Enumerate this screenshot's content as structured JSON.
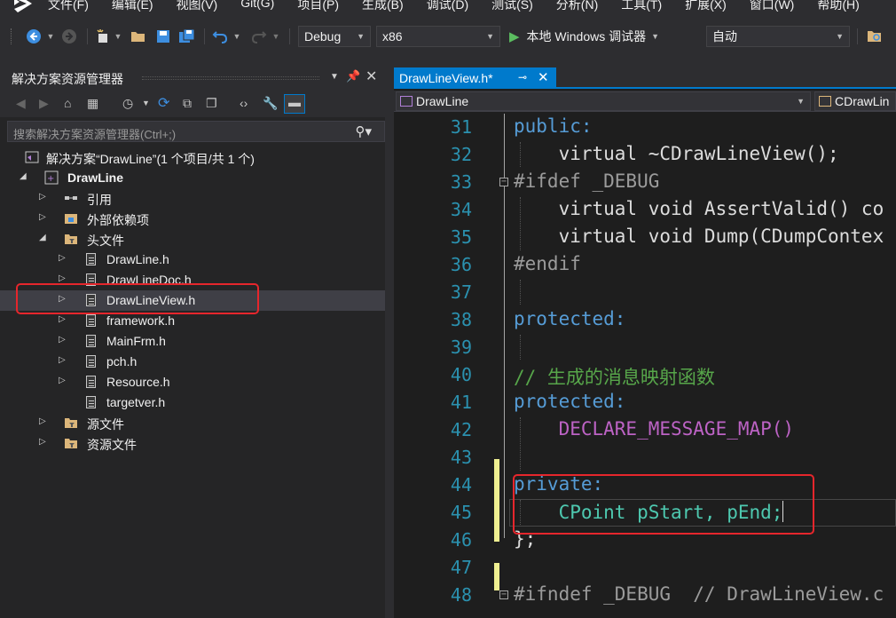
{
  "menu": {
    "items": [
      "文件(F)",
      "编辑(E)",
      "视图(V)",
      "Git(G)",
      "项目(P)",
      "生成(B)",
      "调试(D)",
      "测试(S)",
      "分析(N)",
      "工具(T)",
      "扩展(X)",
      "窗口(W)",
      "帮助(H)"
    ]
  },
  "toolbar": {
    "configuration": "Debug",
    "platform": "x86",
    "run_label": "本地 Windows 调试器",
    "auto_label": "自动"
  },
  "solution_explorer": {
    "title": "解决方案资源管理器",
    "search_placeholder": "搜索解决方案资源管理器(Ctrl+;)",
    "solution_label": "解决方案“DrawLine”(1 个项目/共 1 个)",
    "project_label": "DrawLine",
    "references": "引用",
    "external_deps": "外部依赖项",
    "header_files": "头文件",
    "headers": [
      "DrawLine.h",
      "DrawLineDoc.h",
      "DrawLineView.h",
      "framework.h",
      "MainFrm.h",
      "pch.h",
      "Resource.h",
      "targetver.h"
    ],
    "selected_index": 2,
    "source_files": "源文件",
    "resource_files": "资源文件"
  },
  "editor": {
    "tab_label": "DrawLineView.h*",
    "nav_left": "DrawLine",
    "nav_right": "CDrawLin",
    "lines": [
      {
        "n": "31",
        "text": "public:"
      },
      {
        "n": "32",
        "text": "    virtual ~CDrawLineView();"
      },
      {
        "n": "33",
        "text": "#ifdef _DEBUG"
      },
      {
        "n": "34",
        "text": "    virtual void AssertValid() co"
      },
      {
        "n": "35",
        "text": "    virtual void Dump(CDumpContex"
      },
      {
        "n": "36",
        "text": "#endif"
      },
      {
        "n": "37",
        "text": ""
      },
      {
        "n": "38",
        "text": "protected:"
      },
      {
        "n": "39",
        "text": ""
      },
      {
        "n": "40",
        "text": "// 生成的消息映射函数"
      },
      {
        "n": "41",
        "text": "protected:"
      },
      {
        "n": "42",
        "text": "    DECLARE_MESSAGE_MAP()"
      },
      {
        "n": "43",
        "text": ""
      },
      {
        "n": "44",
        "text": "private:"
      },
      {
        "n": "45",
        "text": "    CPoint pStart, pEnd;"
      },
      {
        "n": "46",
        "text": "};"
      },
      {
        "n": "47",
        "text": ""
      },
      {
        "n": "48",
        "text": "#ifndef _DEBUG  // DrawLineView.c"
      }
    ]
  },
  "colors": {
    "accent": "#007acc",
    "highlight_box": "#e6262c",
    "keyword": "#569cd6",
    "comment": "#57a64a",
    "line_number": "#2b91af"
  }
}
